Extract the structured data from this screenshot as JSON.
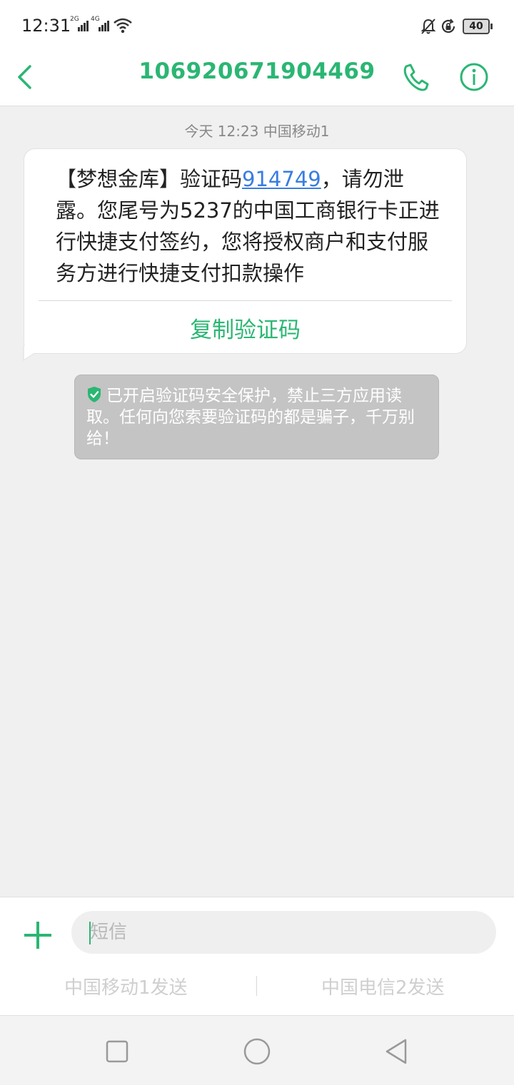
{
  "status_bar": {
    "time": "12:31",
    "signal_1_label": "2G",
    "signal_2_label": "4G",
    "icons": [
      "signal-2g-icon",
      "signal-4g-icon",
      "wifi-icon",
      "mute-icon",
      "rotation-lock-icon"
    ],
    "battery": "40"
  },
  "header": {
    "title": "106920671904469",
    "back_icon": "chevron-left-icon",
    "call_icon": "phone-icon",
    "info_icon": "info-icon",
    "accent_color": "#2bb673"
  },
  "conversation": {
    "timestamp": "今天 12:23  中国移动1",
    "message": {
      "before_code": "【梦想金库】验证码",
      "code": "914749",
      "after_code": "，请勿泄露。您尾号为5237的中国工商银行卡正进行快捷支付签约，您将授权商户和支付服务方进行快捷支付扣款操作",
      "copy_button": "复制验证码"
    },
    "security_notice": "已开启验证码安全保护，禁止三方应用读取。任何向您索要验证码的都是骗子，千万别给！"
  },
  "composer": {
    "placeholder": "短信",
    "value": "",
    "send_sim1": "中国移动1发送",
    "send_sim2": "中国电信2发送"
  },
  "nav_bar": {
    "icons": [
      "recent-apps-icon",
      "home-icon",
      "back-icon"
    ]
  }
}
